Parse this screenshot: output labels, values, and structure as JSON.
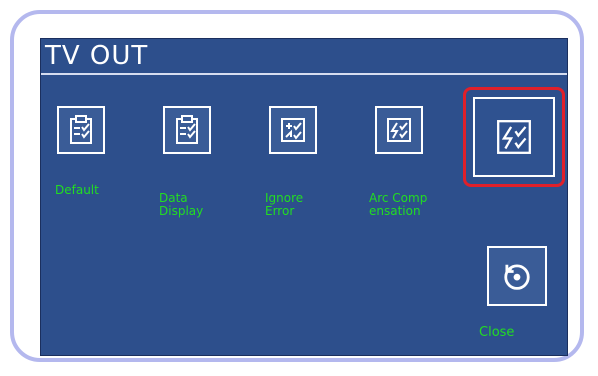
{
  "window": {
    "title": "TV OUT"
  },
  "colors": {
    "screen_bg": "#2d4f8c",
    "label": "#22dd22",
    "highlight": "#e0202a",
    "frame": "#b4b8ee"
  },
  "items": [
    {
      "label_line1": "Default",
      "label_line2": "",
      "icon": "clipboard-check-icon"
    },
    {
      "label_line1": "Data",
      "label_line2": "Display",
      "icon": "clipboard-check-icon"
    },
    {
      "label_line1": "Ignore",
      "label_line2": "Error",
      "icon": "ignore-error-icon"
    },
    {
      "label_line1": "Arc Comp",
      "label_line2": "ensation",
      "icon": "arc-compensation-icon"
    },
    {
      "label_line1": "",
      "label_line2": "",
      "icon": "arc-compensation-icon",
      "selected": true
    }
  ],
  "close": {
    "label": "Close",
    "icon": "undo-circle-icon"
  }
}
